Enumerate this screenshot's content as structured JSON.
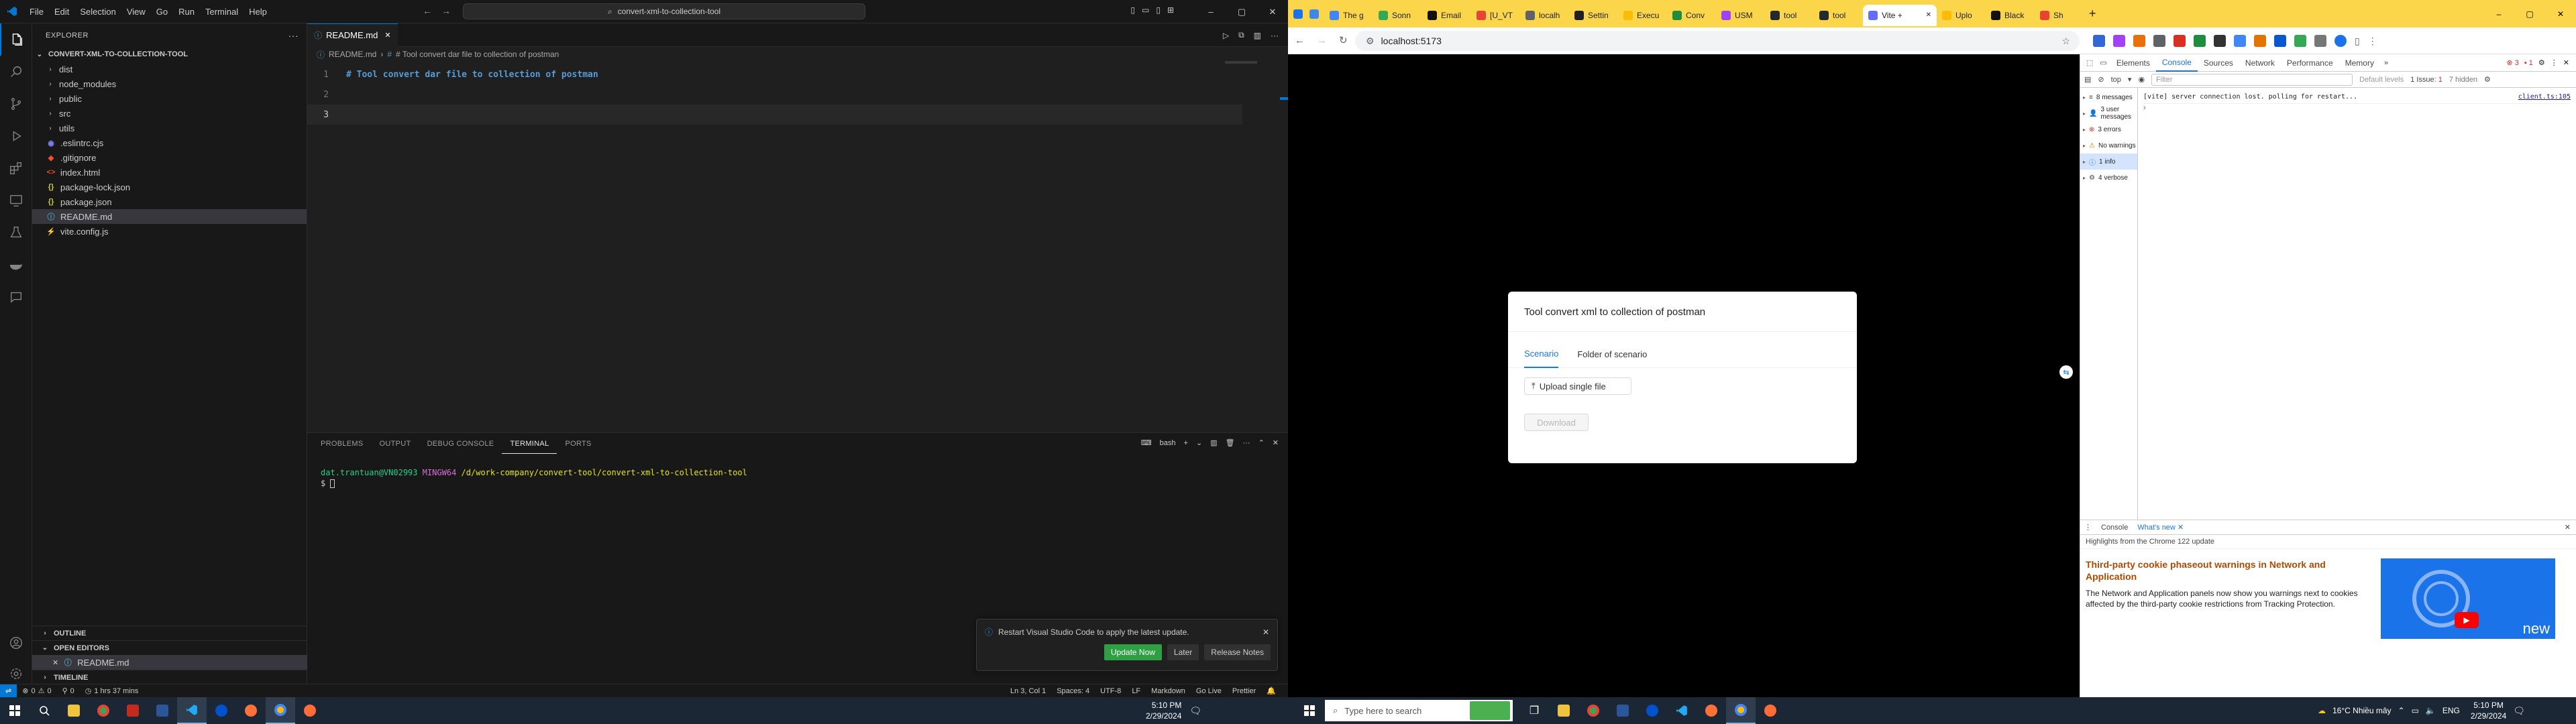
{
  "vscode": {
    "menu": [
      "File",
      "Edit",
      "Selection",
      "View",
      "Go",
      "Run",
      "Terminal",
      "Help"
    ],
    "search_text": "convert-xml-to-collection-tool",
    "explorer_title": "EXPLORER",
    "project": "CONVERT-XML-TO-COLLECTION-TOOL",
    "tree": [
      {
        "name": "dist",
        "type": "folder"
      },
      {
        "name": "node_modules",
        "type": "folder"
      },
      {
        "name": "public",
        "type": "folder"
      },
      {
        "name": "src",
        "type": "folder"
      },
      {
        "name": "utils",
        "type": "folder"
      },
      {
        "name": ".eslintrc.cjs",
        "type": "eslint"
      },
      {
        "name": ".gitignore",
        "type": "git"
      },
      {
        "name": "index.html",
        "type": "html"
      },
      {
        "name": "package-lock.json",
        "type": "json"
      },
      {
        "name": "package.json",
        "type": "json"
      },
      {
        "name": "README.md",
        "type": "md",
        "selected": true
      },
      {
        "name": "vite.config.js",
        "type": "js"
      }
    ],
    "outline_label": "OUTLINE",
    "open_editors_label": "OPEN EDITORS",
    "open_editor_file": "README.md",
    "timeline_label": "TIMELINE",
    "tab_label": "README.md",
    "breadcrumb_file": "README.md",
    "breadcrumb_heading": "# Tool convert dar file to collection of postman",
    "code_lines": [
      {
        "num": "1",
        "text": "# Tool convert dar file to collection of postman"
      },
      {
        "num": "2",
        "text": ""
      },
      {
        "num": "3",
        "text": ""
      }
    ],
    "panel_tabs": [
      "PROBLEMS",
      "OUTPUT",
      "DEBUG CONSOLE",
      "TERMINAL",
      "PORTS"
    ],
    "panel_active": "TERMINAL",
    "terminal_shell": "bash",
    "terminal": {
      "user": "dat.trantuan@VN02993",
      "env": "MINGW64",
      "path": "/d/work-company/convert-tool/convert-xml-to-collection-tool",
      "prompt": "$"
    },
    "notification": {
      "text": "Restart Visual Studio Code to apply the latest update.",
      "primary": "Update Now",
      "secondary": "Later",
      "tertiary": "Release Notes"
    },
    "status_left": {
      "errors": "0",
      "warnings": "0",
      "info": "0",
      "time": "1 hrs 37 mins"
    },
    "status_right": [
      "Ln 3, Col 1",
      "Spaces: 4",
      "UTF-8",
      "LF",
      "Markdown",
      "Go Live",
      "Prettier"
    ]
  },
  "chrome": {
    "tabs": [
      "The g",
      "Sonn",
      "Email",
      "[U_VT",
      "localh",
      "Settin",
      "Execu",
      "Conv",
      "USM",
      "tool",
      "tool",
      "Vite +",
      "Uplo",
      "Black",
      "Sh"
    ],
    "active_tab_index": 11,
    "url": "localhost:5173",
    "card": {
      "title": "Tool convert xml to collection of postman",
      "tabs": [
        "Scenario",
        "Folder of scenario"
      ],
      "active_tab": "Scenario",
      "upload_label": "Upload single file",
      "download_label": "Download"
    },
    "devtools": {
      "tabs": [
        "Elements",
        "Console",
        "Sources",
        "Network",
        "Performance",
        "Memory"
      ],
      "active_tab": "Console",
      "errors_badge": "3",
      "warnings_badge": "1",
      "context": "top",
      "filter_placeholder": "Filter",
      "levels": "Default levels",
      "issues": "1 Issue:",
      "issues_count": "1",
      "hidden": "7 hidden",
      "sidebar": [
        {
          "label": "8 messages",
          "icon": "list"
        },
        {
          "label": "3 user messages",
          "icon": "user"
        },
        {
          "label": "3 errors",
          "icon": "error"
        },
        {
          "label": "No warnings",
          "icon": "warning"
        },
        {
          "label": "1 info",
          "icon": "info",
          "selected": true
        },
        {
          "label": "4 verbose",
          "icon": "verbose"
        }
      ],
      "log_text": "[vite] server connection lost. polling for restart...",
      "log_source": "client.ts:105",
      "drawer_tabs": [
        "Console",
        "What's new"
      ],
      "drawer_highlight": "Highlights from the Chrome 122 update",
      "whatsnew_title": "Third-party cookie phaseout warnings in Network and Application",
      "whatsnew_body": "The Network and Application panels now show you warnings next to cookies affected by the third-party cookie restrictions from Tracking Protection.",
      "video_word": "new"
    }
  },
  "taskbar": {
    "search_placeholder": "Type here to search",
    "weather": "16°C  Nhiều mây",
    "lang": "ENG",
    "time_left": "5:10 PM",
    "date_left": "2/29/2024",
    "time_right": "5:10 PM",
    "date_right": "2/29/2024"
  },
  "colors": {
    "vs_accent": "#0078d4",
    "chrome_tabbar": "#fbd64a",
    "taskbar": "#1b2735",
    "update_btn": "#2ea043"
  }
}
